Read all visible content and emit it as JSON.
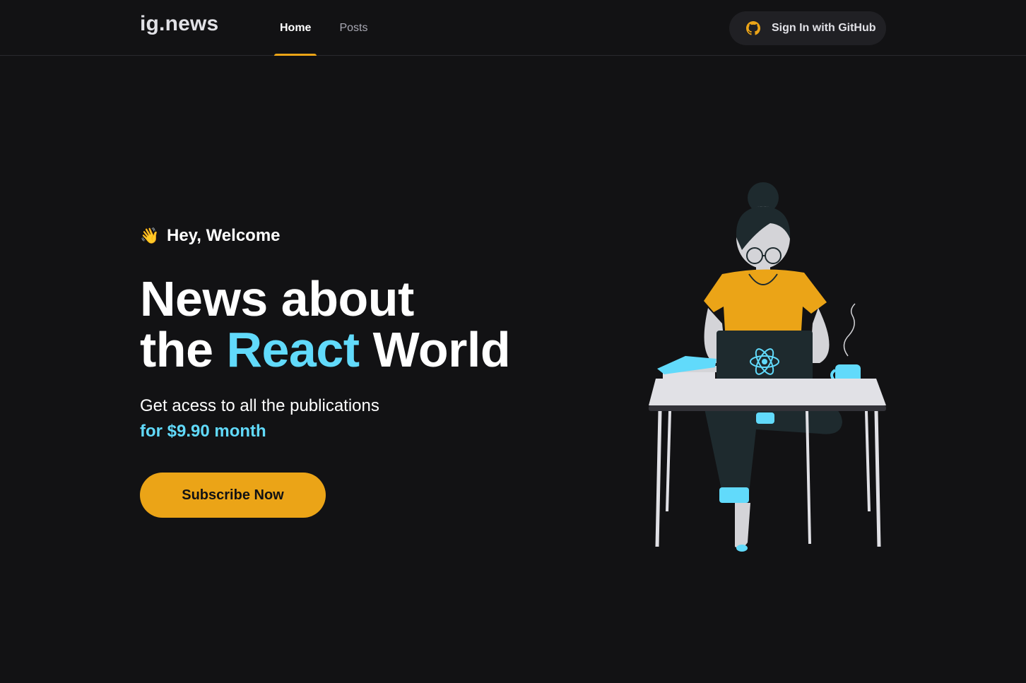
{
  "header": {
    "logo": "ig.news",
    "nav": [
      {
        "label": "Home",
        "active": true
      },
      {
        "label": "Posts",
        "active": false
      }
    ],
    "signin_label": "Sign In with GitHub",
    "signin_icon": "github-icon"
  },
  "hero": {
    "welcome_icon": "👋",
    "welcome": "Hey, Welcome",
    "headline_line1": "News about",
    "headline_the": "the",
    "headline_accent": "React",
    "headline_world": "World",
    "description": "Get acess to all the publications",
    "price": "for $9.90 month",
    "subscribe_label": "Subscribe Now"
  },
  "colors": {
    "background": "#121214",
    "accent_yellow": "#eba417",
    "accent_cyan": "#61dafb",
    "surface": "#202024"
  },
  "illustration": {
    "description_icon": "woman-at-laptop-illustration"
  }
}
